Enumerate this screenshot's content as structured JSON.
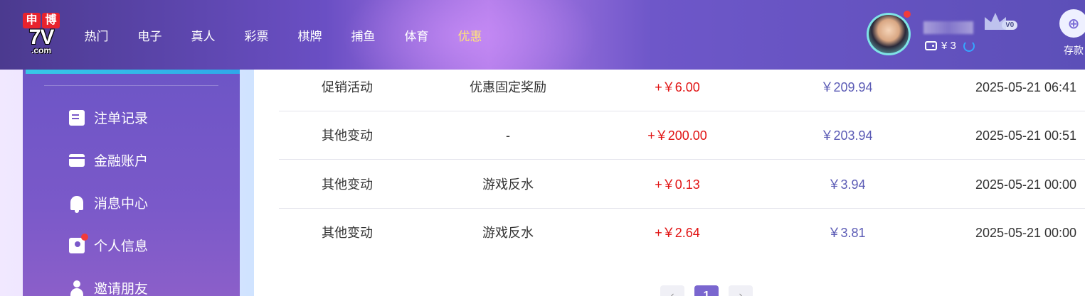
{
  "header": {
    "logo": {
      "top_left": "申",
      "top_right": "博",
      "mid": "7V",
      "bottom": ".com"
    },
    "nav": [
      {
        "label": "热门",
        "active": false
      },
      {
        "label": "电子",
        "active": false
      },
      {
        "label": "真人",
        "active": false
      },
      {
        "label": "彩票",
        "active": false
      },
      {
        "label": "棋牌",
        "active": false
      },
      {
        "label": "捕鱼",
        "active": false
      },
      {
        "label": "体育",
        "active": false
      },
      {
        "label": "优惠",
        "active": true
      }
    ],
    "vip_level": "V0",
    "balance": "¥ 3",
    "deposit_label": "存款"
  },
  "sidebar": {
    "items": [
      {
        "label": "注单记录",
        "icon": "document-icon"
      },
      {
        "label": "金融账户",
        "icon": "card-icon"
      },
      {
        "label": "消息中心",
        "icon": "bell-icon"
      },
      {
        "label": "个人信息",
        "icon": "profile-icon",
        "badge": true
      },
      {
        "label": "邀请朋友",
        "icon": "invite-icon"
      }
    ]
  },
  "table": {
    "rows": [
      {
        "type": "促销活动",
        "detail": "优惠固定奖励",
        "amount": "+￥6.00",
        "balance": "￥209.94",
        "time": "2025-05-21 06:41"
      },
      {
        "type": "其他变动",
        "detail": "-",
        "amount": "+￥200.00",
        "balance": "￥203.94",
        "time": "2025-05-21 00:51"
      },
      {
        "type": "其他变动",
        "detail": "游戏反水",
        "amount": "+￥0.13",
        "balance": "￥3.94",
        "time": "2025-05-21 00:00"
      },
      {
        "type": "其他变动",
        "detail": "游戏反水",
        "amount": "+￥2.64",
        "balance": "￥3.81",
        "time": "2025-05-21 00:00"
      }
    ]
  },
  "pagination": {
    "prev": "‹",
    "current": "1",
    "next": "›"
  },
  "colors": {
    "accent": "#7a66cf",
    "amount_positive": "#e11414",
    "balance_text": "#5b5bb5",
    "nav_active": "#ffe27a"
  }
}
